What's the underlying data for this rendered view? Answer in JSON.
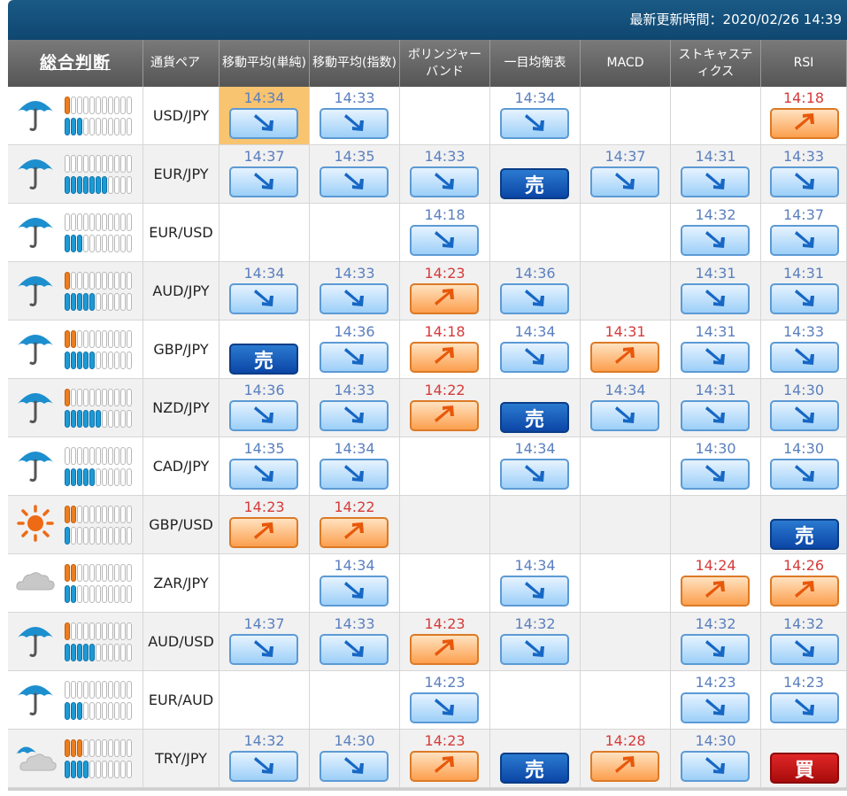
{
  "header": {
    "updated": "最新更新時間：2020/02/26 14:39"
  },
  "columns": [
    "総合判断",
    "通貨ペア",
    "移動平均(単純)",
    "移動平均(指数)",
    "ボリンジャーバンド",
    "一目均衡表",
    "MACD",
    "ストキャスティクス",
    "RSI"
  ],
  "signal_text": {
    "sell": "売",
    "buy": "買"
  },
  "colors": {
    "down": "#5a7fbf",
    "up": "#d63a3a",
    "sell": "#0c46a6",
    "buy": "#c01010",
    "highlight": "#f8c470"
  },
  "rows": [
    {
      "pair": "USD/JPY",
      "weather": "umbrella-icon",
      "orange": 1,
      "blue": 3,
      "highlight": [
        0
      ],
      "signals": [
        [
          "14:34",
          "down"
        ],
        [
          "14:33",
          "down"
        ],
        null,
        [
          "14:34",
          "down"
        ],
        null,
        null,
        [
          "14:18",
          "up"
        ]
      ]
    },
    {
      "pair": "EUR/JPY",
      "weather": "umbrella-icon",
      "orange": 0,
      "blue": 7,
      "signals": [
        [
          "14:37",
          "down"
        ],
        [
          "14:35",
          "down"
        ],
        [
          "14:33",
          "down"
        ],
        [
          "",
          "sell"
        ],
        [
          "14:37",
          "down"
        ],
        [
          "14:31",
          "down"
        ],
        [
          "14:33",
          "down"
        ]
      ]
    },
    {
      "pair": "EUR/USD",
      "weather": "umbrella-icon",
      "orange": 0,
      "blue": 3,
      "signals": [
        null,
        null,
        [
          "14:18",
          "down"
        ],
        null,
        null,
        [
          "14:32",
          "down"
        ],
        [
          "14:37",
          "down"
        ]
      ]
    },
    {
      "pair": "AUD/JPY",
      "weather": "umbrella-icon",
      "orange": 1,
      "blue": 5,
      "signals": [
        [
          "14:34",
          "down"
        ],
        [
          "14:33",
          "down"
        ],
        [
          "14:23",
          "up"
        ],
        [
          "14:36",
          "down"
        ],
        null,
        [
          "14:31",
          "down"
        ],
        [
          "14:31",
          "down"
        ]
      ]
    },
    {
      "pair": "GBP/JPY",
      "weather": "umbrella-icon",
      "orange": 2,
      "blue": 5,
      "signals": [
        [
          "",
          "sell"
        ],
        [
          "14:36",
          "down"
        ],
        [
          "14:18",
          "up"
        ],
        [
          "14:34",
          "down"
        ],
        [
          "14:31",
          "up"
        ],
        [
          "14:31",
          "down"
        ],
        [
          "14:33",
          "down"
        ]
      ]
    },
    {
      "pair": "NZD/JPY",
      "weather": "umbrella-icon",
      "orange": 1,
      "blue": 6,
      "signals": [
        [
          "14:36",
          "down"
        ],
        [
          "14:33",
          "down"
        ],
        [
          "14:22",
          "up"
        ],
        [
          "",
          "sell"
        ],
        [
          "14:34",
          "down"
        ],
        [
          "14:31",
          "down"
        ],
        [
          "14:30",
          "down"
        ]
      ]
    },
    {
      "pair": "CAD/JPY",
      "weather": "umbrella-icon",
      "orange": 0,
      "blue": 5,
      "signals": [
        [
          "14:35",
          "down"
        ],
        [
          "14:34",
          "down"
        ],
        null,
        [
          "14:34",
          "down"
        ],
        null,
        [
          "14:30",
          "down"
        ],
        [
          "14:30",
          "down"
        ]
      ]
    },
    {
      "pair": "GBP/USD",
      "weather": "sun-icon",
      "orange": 2,
      "blue": 1,
      "signals": [
        [
          "14:23",
          "up"
        ],
        [
          "14:22",
          "up"
        ],
        null,
        null,
        null,
        null,
        [
          "",
          "sell"
        ]
      ]
    },
    {
      "pair": "ZAR/JPY",
      "weather": "cloud-icon",
      "orange": 2,
      "blue": 2,
      "signals": [
        null,
        [
          "14:34",
          "down"
        ],
        null,
        [
          "14:34",
          "down"
        ],
        null,
        [
          "14:24",
          "up"
        ],
        [
          "14:26",
          "up"
        ]
      ]
    },
    {
      "pair": "AUD/USD",
      "weather": "umbrella-icon",
      "orange": 1,
      "blue": 5,
      "signals": [
        [
          "14:37",
          "down"
        ],
        [
          "14:33",
          "down"
        ],
        [
          "14:23",
          "up"
        ],
        [
          "14:32",
          "down"
        ],
        null,
        [
          "14:32",
          "down"
        ],
        [
          "14:32",
          "down"
        ]
      ]
    },
    {
      "pair": "EUR/AUD",
      "weather": "umbrella-icon",
      "orange": 0,
      "blue": 3,
      "signals": [
        null,
        null,
        [
          "14:23",
          "down"
        ],
        null,
        null,
        [
          "14:23",
          "down"
        ],
        [
          "14:23",
          "down"
        ]
      ]
    },
    {
      "pair": "TRY/JPY",
      "weather": "rain-cloud-icon",
      "orange": 3,
      "blue": 4,
      "signals": [
        [
          "14:32",
          "down"
        ],
        [
          "14:30",
          "down"
        ],
        [
          "14:23",
          "up"
        ],
        [
          "",
          "sell"
        ],
        [
          "14:28",
          "up"
        ],
        [
          "14:30",
          "down"
        ],
        [
          "",
          "buy"
        ]
      ]
    }
  ]
}
